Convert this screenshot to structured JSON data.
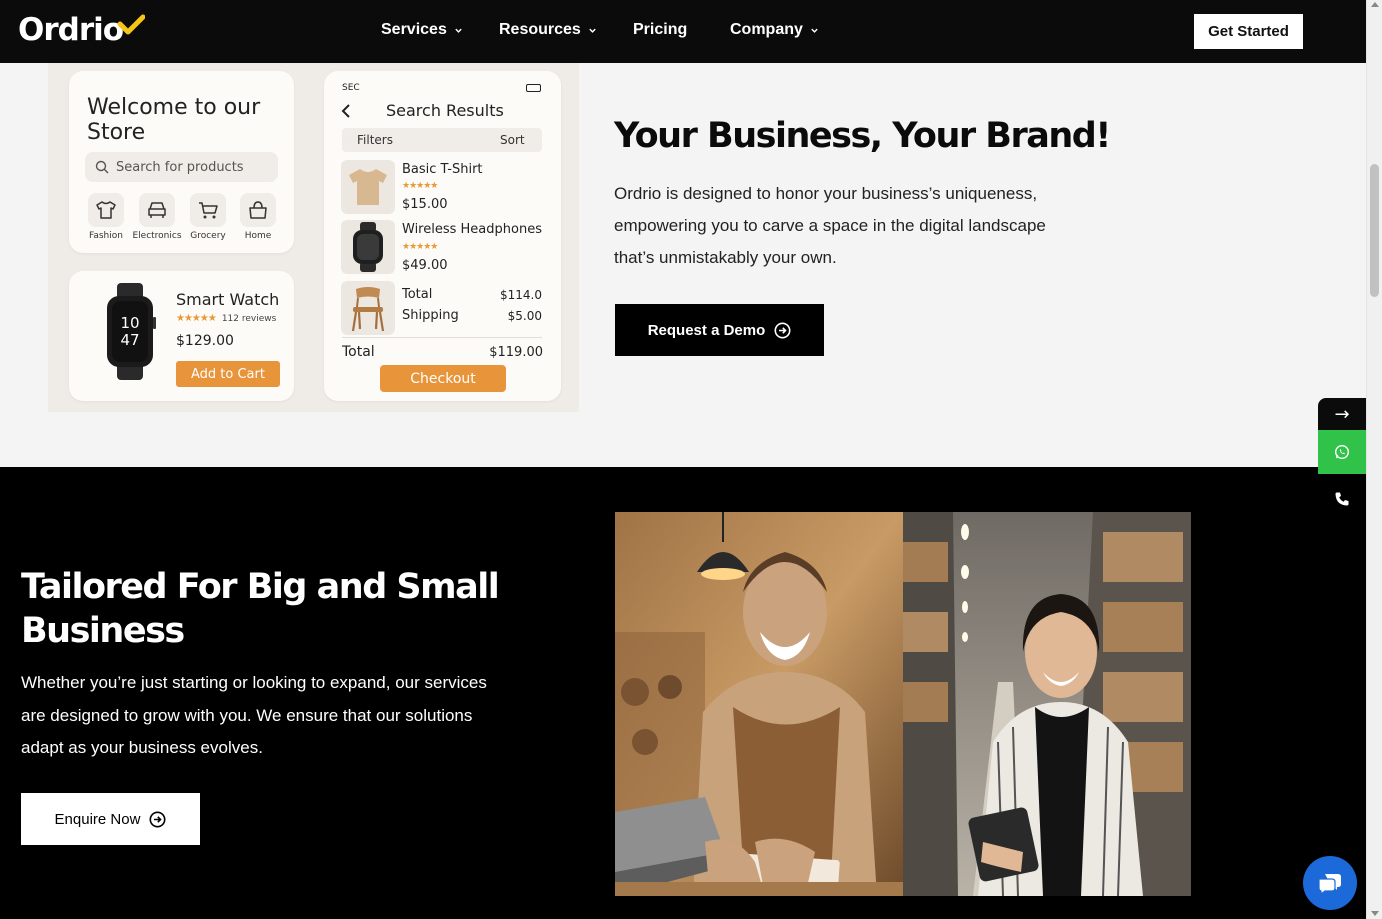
{
  "header": {
    "logo": "Ordrio",
    "nav": [
      {
        "label": "Services",
        "dropdown": true
      },
      {
        "label": "Resources",
        "dropdown": true
      },
      {
        "label": "Pricing",
        "dropdown": false
      },
      {
        "label": "Company",
        "dropdown": true
      }
    ],
    "cta": "Get Started"
  },
  "mockup": {
    "store": {
      "title": "Welcome to our Store",
      "search_placeholder": "Search for products",
      "categories": [
        "Fashion",
        "Electronics",
        "Grocery",
        "Home"
      ]
    },
    "product": {
      "name": "Smart Watch",
      "watch_time_hours": "10",
      "watch_time_minutes": "47",
      "rating": 4.5,
      "reviews": "112 reviews",
      "price": "$129.00",
      "button": "Add to Cart"
    },
    "results": {
      "status": "SEC",
      "title": "Search Results",
      "filters": "Filters",
      "sort": "Sort",
      "items": [
        {
          "name": "Basic T-Shirt",
          "price": "$15.00",
          "rating": 5
        },
        {
          "name": "Wireless Headphones",
          "price": "$49.00",
          "rating": 5
        }
      ],
      "subtotal_label": "Total",
      "subtotal_value": "$114.0",
      "shipping_label": "Shipping",
      "shipping_value": "$5.00",
      "total_label": "Total",
      "total_value": "$119.00",
      "button": "Checkout"
    }
  },
  "brand_section": {
    "heading": "Your Business, Your Brand!",
    "body": "Ordrio is designed to honor your business’s uniqueness, empowering you to carve a space in the digital landscape that’s unmistakably your own.",
    "cta": "Request a Demo"
  },
  "tailored_section": {
    "heading": "Tailored For Big and Small Business",
    "body": "Whether you’re just starting or looking to expand, our services are designed to grow with you. We ensure that our solutions adapt as your business evolves.",
    "cta": "Enquire Now"
  },
  "side_buttons": {
    "arrow": "→"
  },
  "colors": {
    "accent_orange": "#e8943a",
    "logo_check": "#f5c518",
    "whatsapp_green": "#31c24a",
    "chat_blue": "#1c6ad9"
  }
}
